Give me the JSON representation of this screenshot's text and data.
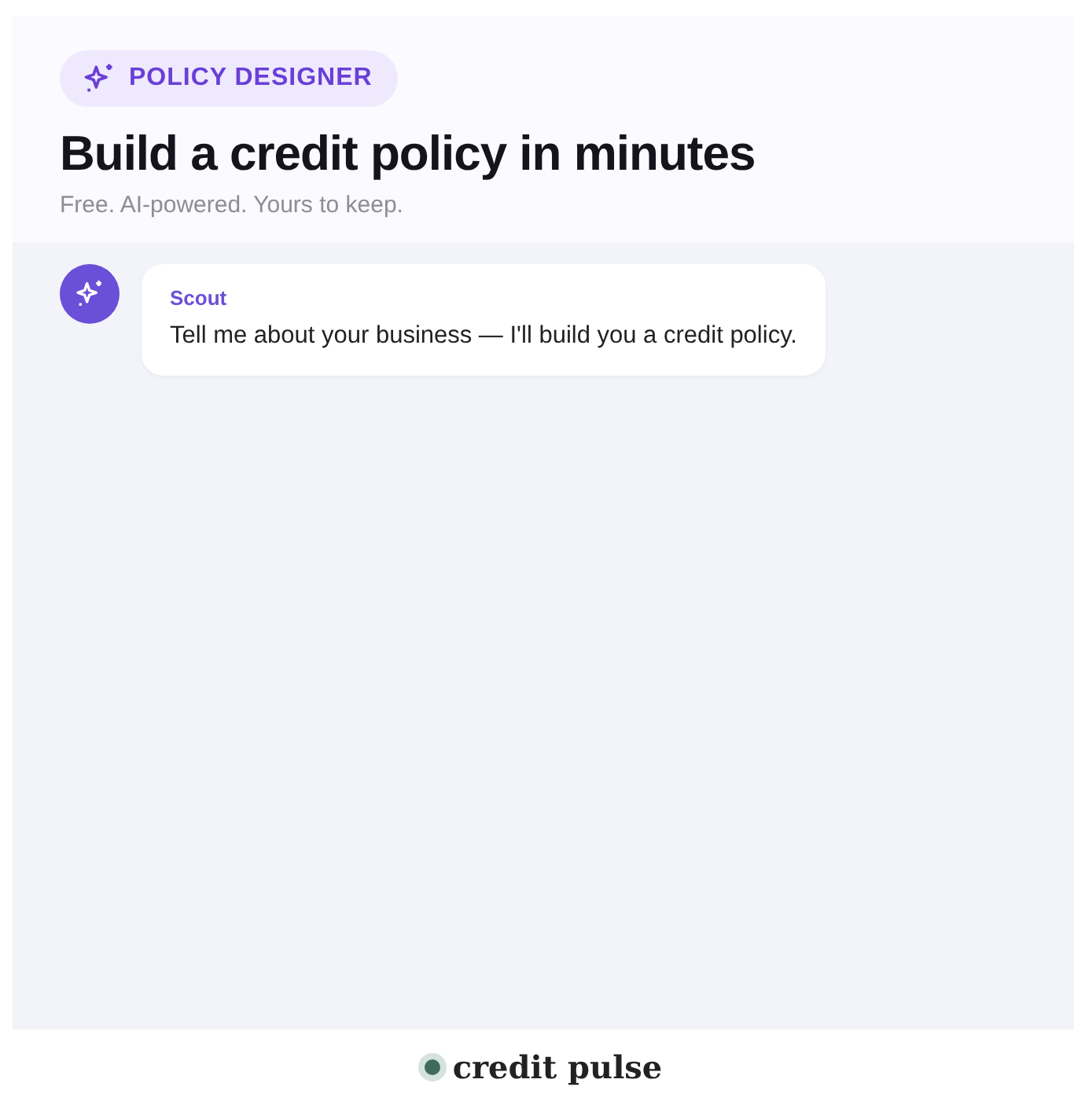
{
  "badge": {
    "label": "POLICY DESIGNER"
  },
  "title": "Build a credit policy in minutes",
  "subtitle": "Free. AI-powered. Yours to keep.",
  "messages": [
    {
      "sender": "Scout",
      "text": "Tell me about your business — I'll build you a credit policy."
    }
  ],
  "footer": {
    "brand": "credit pulse"
  }
}
